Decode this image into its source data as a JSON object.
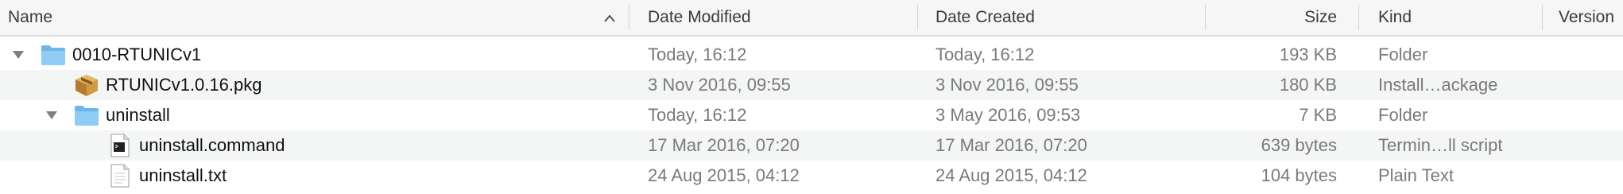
{
  "columns": {
    "name": "Name",
    "date_modified": "Date Modified",
    "date_created": "Date Created",
    "size": "Size",
    "kind": "Kind",
    "version": "Version"
  },
  "rows": [
    {
      "name": "0010-RTUNICv1",
      "date_modified": "Today, 16:12",
      "date_created": "Today, 16:12",
      "size": "193 KB",
      "kind": "Folder",
      "icon": "folder-icon",
      "expanded": true
    },
    {
      "name": "RTUNICv1.0.16.pkg",
      "date_modified": "3 Nov 2016, 09:55",
      "date_created": "3 Nov 2016, 09:55",
      "size": "180 KB",
      "kind": "Install…ackage",
      "icon": "package-icon"
    },
    {
      "name": "uninstall",
      "date_modified": "Today, 16:12",
      "date_created": "3 May 2016, 09:53",
      "size": "7 KB",
      "kind": "Folder",
      "icon": "folder-icon",
      "expanded": true
    },
    {
      "name": "uninstall.command",
      "date_modified": "17 Mar 2016, 07:20",
      "date_created": "17 Mar 2016, 07:20",
      "size": "639 bytes",
      "kind": "Termin…ll script",
      "icon": "terminal-script-icon"
    },
    {
      "name": "uninstall.txt",
      "date_modified": "24 Aug 2015, 04:12",
      "date_created": "24 Aug 2015, 04:12",
      "size": "104 bytes",
      "kind": "Plain Text",
      "icon": "text-file-icon"
    }
  ],
  "colors": {
    "folder": "#7cc3f0",
    "header_bg": "#f6f6f6",
    "alt_row": "#f4f5f5",
    "secondary_text": "#7a7a7a"
  }
}
